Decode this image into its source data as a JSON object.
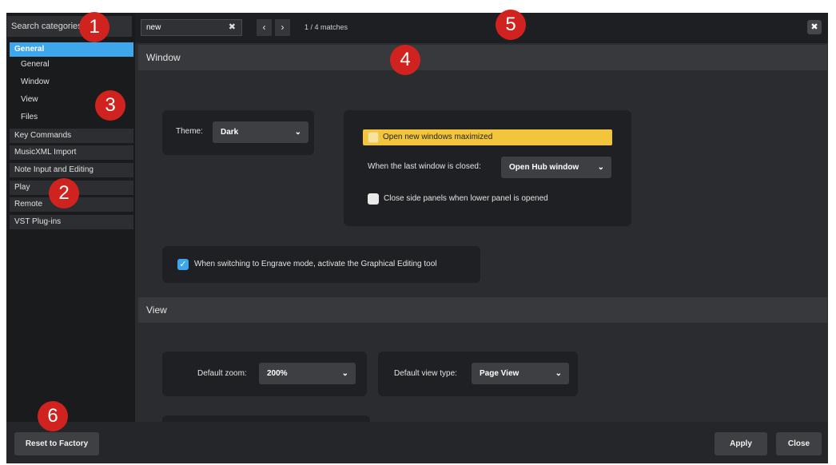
{
  "sidebar": {
    "search_placeholder": "Search categories",
    "categories": [
      {
        "label": "General",
        "selected": true
      },
      {
        "label": "Key Commands"
      },
      {
        "label": "MusicXML Import"
      },
      {
        "label": "Note Input and Editing"
      },
      {
        "label": "Play"
      },
      {
        "label": "Remote"
      },
      {
        "label": "VST Plug-ins"
      }
    ],
    "subitems": [
      "General",
      "Window",
      "View",
      "Files"
    ]
  },
  "find_bar": {
    "value": "new",
    "clear_glyph": "✖",
    "prev_glyph": "‹",
    "next_glyph": "›",
    "match_count": "1 / 4 matches",
    "close_glyph": "✖"
  },
  "window_section": {
    "title": "Window",
    "theme_label": "Theme:",
    "theme_value": "Dark",
    "open_maximized_label": "Open new windows maximized",
    "last_window_label": "When the last window is closed:",
    "last_window_value": "Open Hub window",
    "close_side_panels_label": "Close side panels when lower panel is opened",
    "engrave_label": "When switching to Engrave mode, activate the Graphical Editing tool",
    "engrave_checked": true
  },
  "view_section": {
    "title": "View",
    "default_zoom_label": "Default zoom:",
    "default_zoom_value": "200%",
    "default_view_label": "Default view type:",
    "default_view_value": "Page View"
  },
  "footer": {
    "reset_label": "Reset to Factory",
    "apply_label": "Apply",
    "close_label": "Close"
  },
  "callouts": [
    "1",
    "2",
    "3",
    "4",
    "5",
    "6"
  ],
  "colors": {
    "accent": "#3ea6ea",
    "highlight": "#f2c53d",
    "callout": "#d0231f",
    "background": "#2b2c2f"
  },
  "icons": {
    "dropdown": "chevron-down-icon",
    "check": "checkmark-icon",
    "clear": "clear-icon",
    "close": "close-icon"
  }
}
